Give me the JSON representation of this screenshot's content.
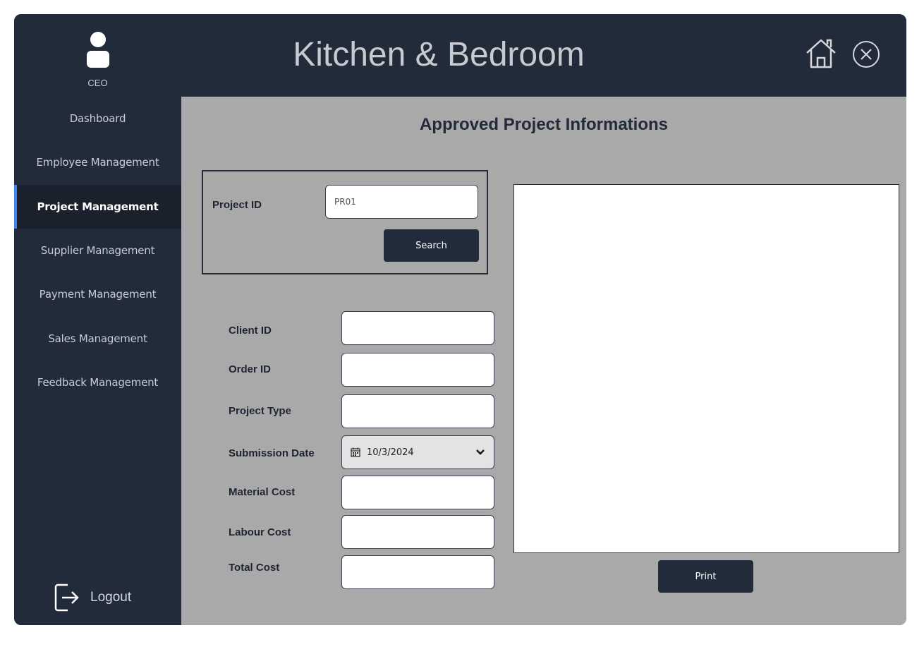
{
  "user": {
    "role": "CEO",
    "icon": "user-avatar-icon"
  },
  "app": {
    "title": "Kitchen & Bedroom",
    "home_icon": "home-icon",
    "close_icon": "close-circle-icon"
  },
  "sidebar": {
    "items": [
      {
        "label": "Dashboard",
        "active": false
      },
      {
        "label": "Employee Management",
        "active": false
      },
      {
        "label": "Project Management",
        "active": true
      },
      {
        "label": "Supplier Management",
        "active": false
      },
      {
        "label": "Payment Management",
        "active": false
      },
      {
        "label": "Sales Management",
        "active": false
      },
      {
        "label": "Feedback Management",
        "active": false
      }
    ],
    "logout_label": "Logout",
    "logout_icon": "logout-icon"
  },
  "page": {
    "title": "Approved Project Informations"
  },
  "search": {
    "project_id_label": "Project ID",
    "project_id_value": "PR01",
    "search_label": "Search"
  },
  "form": {
    "client_id_label": "Client ID",
    "client_id_value": "",
    "order_id_label": "Order ID",
    "order_id_value": "",
    "project_type_label": "Project Type",
    "project_type_value": "",
    "submission_date_label": "Submission Date",
    "submission_date_value": "10/3/2024",
    "material_cost_label": "Material Cost",
    "material_cost_value": "",
    "labour_cost_label": "Labour Cost",
    "labour_cost_value": "",
    "total_cost_label": "Total Cost",
    "total_cost_value": ""
  },
  "actions": {
    "print_label": "Print"
  },
  "colors": {
    "sidebar_bg": "#222b3a",
    "content_bg": "#a9a9a9",
    "accent": "#3d86f0",
    "button_bg": "#222b3a"
  }
}
